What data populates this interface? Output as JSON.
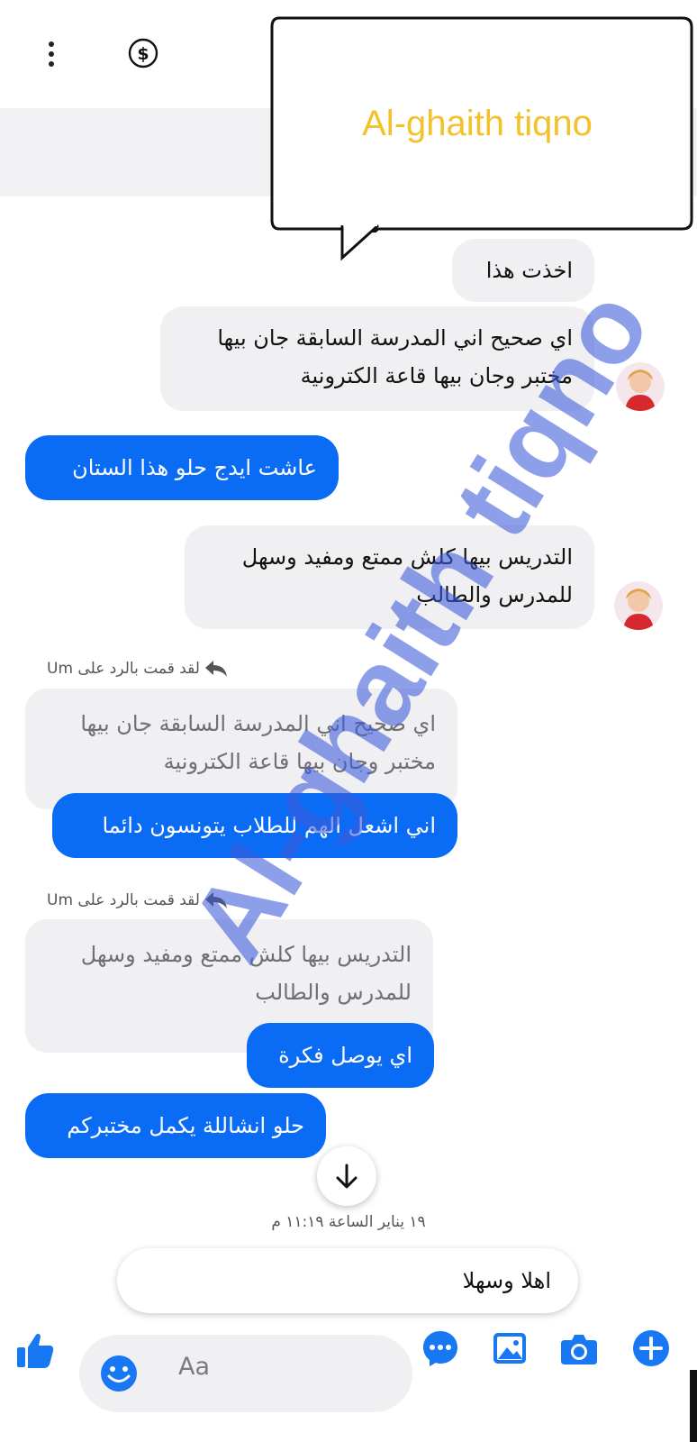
{
  "watermark_text": "Al-ghaith tiqno",
  "callout": {
    "text": "Al-ghaith tiqno"
  },
  "header": {
    "menu_icon": "more-vertical-icon",
    "payment_icon": "dollar-circle-icon"
  },
  "messages": {
    "m1": {
      "text": "اخذت هذا"
    },
    "m2": {
      "line1": "اي صحيح اني المدرسة السابقة جان بيها",
      "line2": "مختبر وجان بيها قاعة الكترونية"
    },
    "m3": {
      "text": "عاشت ايدج حلو هذا الستان"
    },
    "m4": {
      "line1": "التدريس بيها كلش ممتع ومفيد وسهل",
      "line2": "للمدرس والطالب"
    },
    "reply1": {
      "label": "لقد قمت بالرد على Um",
      "quoted_line1": "اي صحيح اني المدرسة السابقة جان بيها",
      "quoted_line2": "مختبر وجان بيها قاعة الكترونية",
      "text": "اني اشعل الهم للطلاب يتونسون دائما"
    },
    "reply2": {
      "label": "لقد قمت بالرد على Um",
      "quoted_line1": "التدريس بيها كلش ممتع ومفيد وسهل",
      "quoted_line2": "للمدرس والطالب",
      "text": "اي يوصل فكرة"
    },
    "m5": {
      "text": "حلو انشاللة يكمل مختبركم"
    }
  },
  "timestamp": "١٩ يناير الساعة ١١:١٩ م",
  "suggested_reply": "اهلا وسهلا",
  "composer": {
    "placeholder": "Aa"
  },
  "colors": {
    "outgoing": "#0a6cf5",
    "incoming": "#f0f0f3",
    "accent": "#1877f2",
    "callout_text": "#f3c12a"
  }
}
